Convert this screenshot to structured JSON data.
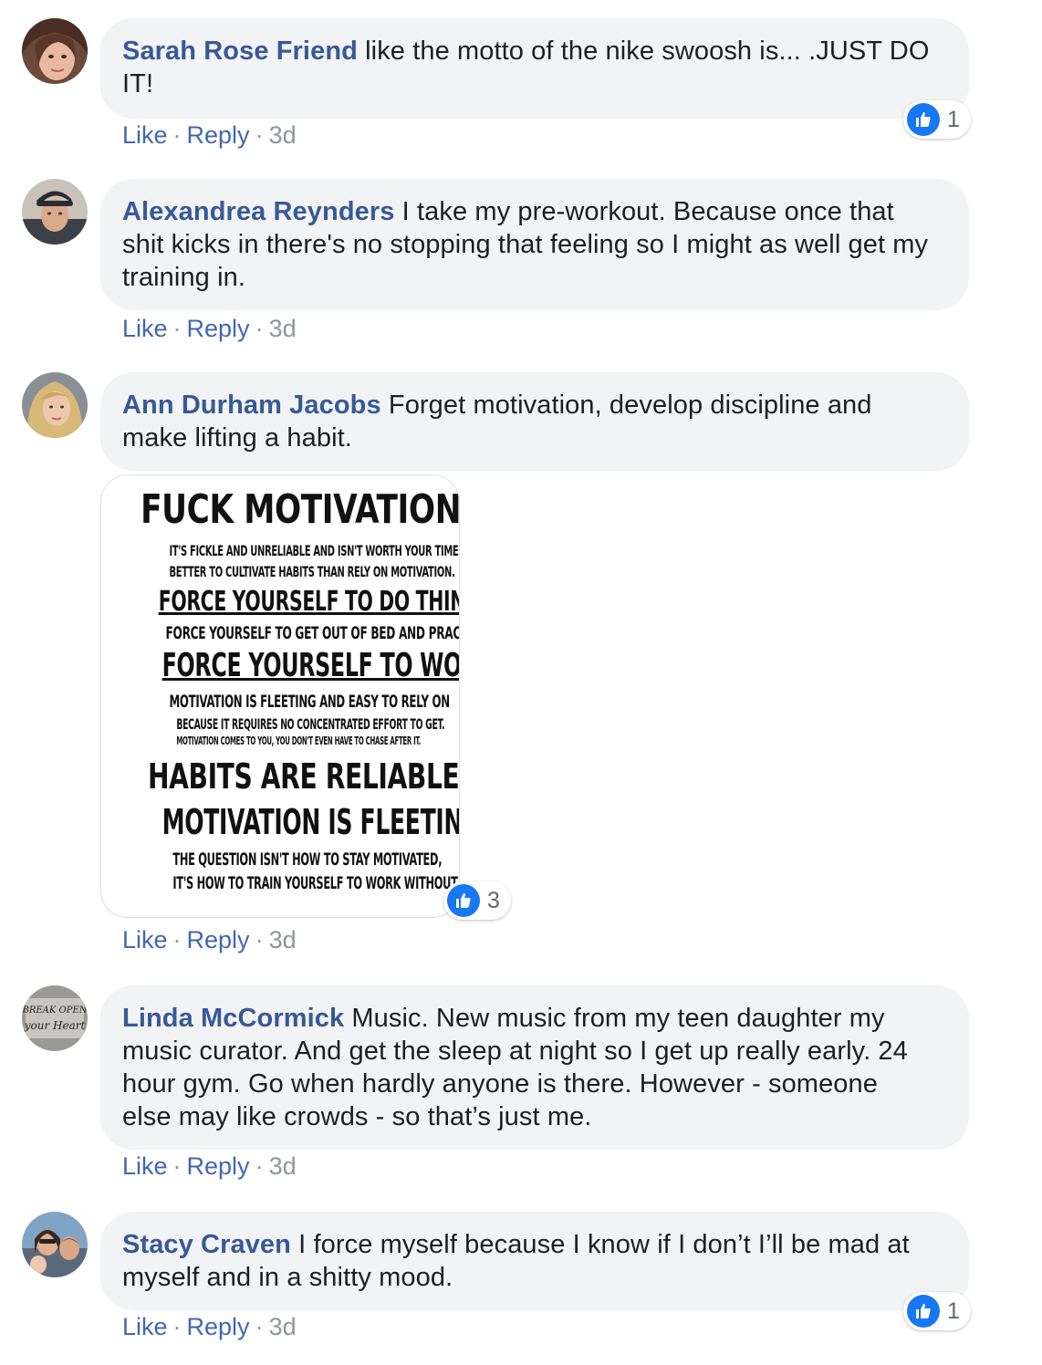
{
  "comments": [
    {
      "author": "Sarah Rose Friend",
      "text": "like the motto of the nike swoosh is... .JUST DO IT!",
      "like": "Like",
      "reply": "Reply",
      "time": "3d",
      "reactions": "1"
    },
    {
      "author": "Alexandrea Reynders",
      "text": "I take my pre-workout. Because once that shit kicks in there's no stopping that feeling so I might as well get my training in.",
      "like": "Like",
      "reply": "Reply",
      "time": "3d"
    },
    {
      "author": "Ann Durham Jacobs",
      "text": "Forget motivation, develop discipline and make lifting a habit.",
      "like": "Like",
      "reply": "Reply",
      "time": "3d",
      "reactions": "3",
      "image_text": {
        "l1": "FUCK MOTIVATION",
        "l2": "IT'S FICKLE AND UNRELIABLE AND ISN'T WORTH YOUR TIME.",
        "l3": "BETTER TO CULTIVATE HABITS THAN RELY ON MOTIVATION.",
        "l4": "FORCE YOURSELF TO DO THINGS.",
        "l5": "FORCE YOURSELF TO GET OUT OF BED AND PRACTICE.",
        "l6": "FORCE YOURSELF TO WORK.",
        "l7": "MOTIVATION IS FLEETING AND EASY TO RELY ON",
        "l8": "BECAUSE IT REQUIRES NO CONCENTRATED EFFORT TO GET.",
        "l9": "MOTIVATION COMES TO YOU, YOU DON'T EVEN HAVE TO CHASE AFTER IT.",
        "l10": "HABITS ARE RELIABLE.",
        "l11": "MOTIVATION IS FLEETING.",
        "l12": "THE QUESTION ISN'T HOW TO STAY MOTIVATED,",
        "l13": "IT'S HOW TO TRAIN YOURSELF TO WORK WITHOUT IT."
      }
    },
    {
      "author": "Linda McCormick",
      "text": "Music. New music from my teen daughter my music curator. And get the sleep at night so I get up really early. 24 hour gym. Go when hardly anyone is there. However - someone else may like crowds - so that’s just me.",
      "like": "Like",
      "reply": "Reply",
      "time": "3d",
      "avatar_text": {
        "a": "BREAK OPEN",
        "b": "your Heart"
      }
    },
    {
      "author": "Stacy Craven",
      "text": "I force myself because I know if I don’t I’ll be mad at myself and in a shitty mood.",
      "like": "Like",
      "reply": "Reply",
      "time": "3d",
      "reactions": "1"
    }
  ],
  "colors": {
    "author": "#385898",
    "link": "#4267b2",
    "meta": "#90949c",
    "bubble": "#f2f3f5",
    "like_badge": "#1877f2"
  },
  "icons": {
    "reaction": "thumbs-up-icon"
  }
}
